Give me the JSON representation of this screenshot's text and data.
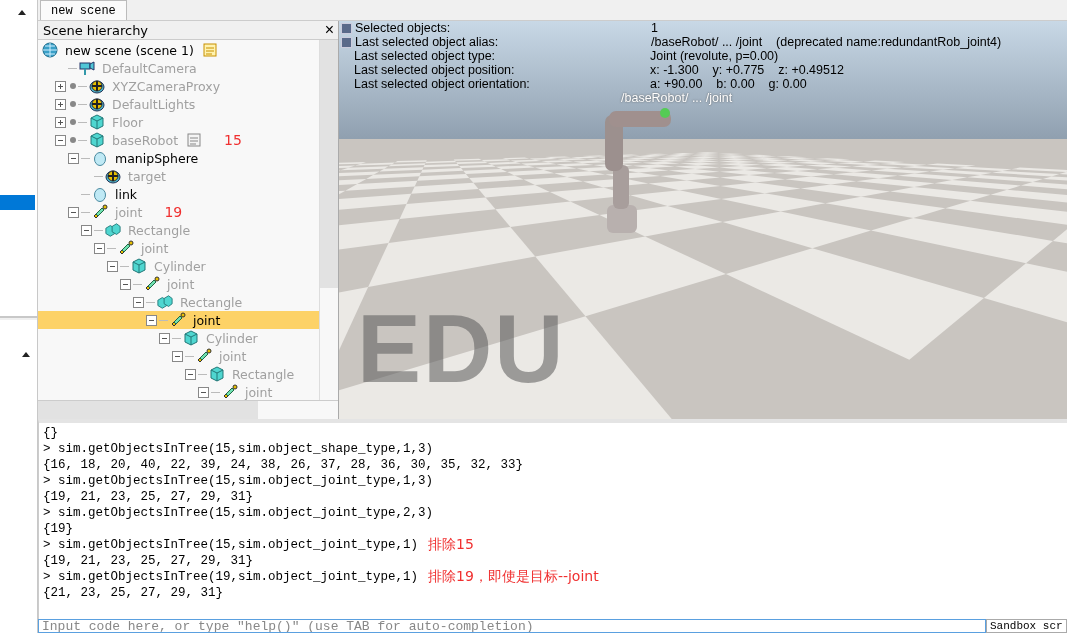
{
  "scene_tab": {
    "label": "new scene",
    "selected": true
  },
  "hierarchy": {
    "title": "Scene hierarchy",
    "close": "×",
    "items": [
      {
        "label": "new scene (scene 1)",
        "kind": "scene",
        "script": true,
        "dimmed": false,
        "selected": false,
        "children": [
          {
            "label": "DefaultCamera",
            "kind": "camera",
            "dimmed": true,
            "selected": false
          },
          {
            "label": "XYZCameraProxy",
            "kind": "dummy",
            "model": true,
            "dimmed": true,
            "selected": false,
            "expanded": false
          },
          {
            "label": "DefaultLights",
            "kind": "dummy",
            "model": true,
            "dimmed": true,
            "selected": false,
            "expanded": false
          },
          {
            "label": "Floor",
            "kind": "shape",
            "model": true,
            "dimmed": true,
            "selected": false,
            "expanded": false
          },
          {
            "label": "baseRobot",
            "kind": "shape",
            "model": true,
            "script": true,
            "note": "15",
            "dimmed": true,
            "selected": false,
            "expanded": true,
            "children": [
              {
                "label": "manipSphere",
                "kind": "sphere",
                "dimmed": false,
                "selected": false,
                "expanded": true,
                "children": [
                  {
                    "label": "target",
                    "kind": "dummy",
                    "dimmed": true,
                    "selected": false
                  }
                ]
              },
              {
                "label": "link",
                "kind": "sphere",
                "dimmed": false,
                "selected": false
              },
              {
                "label": "joint",
                "kind": "joint",
                "note": "19",
                "dimmed": true,
                "selected": false,
                "expanded": true,
                "children": [
                  {
                    "label": "Rectangle",
                    "kind": "compound",
                    "dimmed": true,
                    "selected": false,
                    "expanded": true,
                    "children": [
                      {
                        "label": "joint",
                        "kind": "joint",
                        "dimmed": true,
                        "selected": false,
                        "expanded": true,
                        "children": [
                          {
                            "label": "Cylinder",
                            "kind": "shape",
                            "dimmed": true,
                            "selected": false,
                            "expanded": true,
                            "children": [
                              {
                                "label": "joint",
                                "kind": "joint",
                                "dimmed": true,
                                "selected": false,
                                "expanded": true,
                                "children": [
                                  {
                                    "label": "Rectangle",
                                    "kind": "compound",
                                    "dimmed": true,
                                    "selected": false,
                                    "expanded": true,
                                    "children": [
                                      {
                                        "label": "joint",
                                        "kind": "joint",
                                        "dimmed": false,
                                        "selected": true,
                                        "expanded": true,
                                        "children": [
                                          {
                                            "label": "Cylinder",
                                            "kind": "shape",
                                            "dimmed": true,
                                            "selected": false,
                                            "expanded": true,
                                            "children": [
                                              {
                                                "label": "joint",
                                                "kind": "joint",
                                                "dimmed": true,
                                                "selected": false,
                                                "expanded": true,
                                                "children": [
                                                  {
                                                    "label": "Rectangle",
                                                    "kind": "shape",
                                                    "dimmed": true,
                                                    "selected": false,
                                                    "expanded": true,
                                                    "children": [
                                                      {
                                                        "label": "joint",
                                                        "kind": "joint",
                                                        "dimmed": true,
                                                        "selected": false,
                                                        "expanded": true
                                                      }
                                                    ]
                                                  }
                                                ]
                                              }
                                            ]
                                          }
                                        ]
                                      }
                                    ]
                                  }
                                ]
                              }
                            ]
                          }
                        ]
                      }
                    ]
                  }
                ]
              }
            ]
          }
        ]
      }
    ]
  },
  "info": [
    {
      "label": "Selected objects:",
      "value": "1"
    },
    {
      "label": "Last selected object alias:",
      "value": "/baseRobot/ ... /joint    (deprecated name:redundantRob_joint4)"
    },
    {
      "label": "Last selected object type:",
      "value": "Joint (revolute, p=0.00)"
    },
    {
      "label": "Last selected object position:",
      "value": "x: -1.300    y: +0.775    z: +0.49512"
    },
    {
      "label": "Last selected object orientation:",
      "value": "a: +90.00    b: 0.00    g: 0.00"
    }
  ],
  "viewport": {
    "object_label": "/baseRobot/ ... /joint",
    "edition_mark": "EDU"
  },
  "console": [
    {
      "text": "{}"
    },
    {
      "text": "> sim.getObjectsInTree(15,sim.object_shape_type,1,3)"
    },
    {
      "text": "{16, 18, 20, 40, 22, 39, 24, 38, 26, 37, 28, 36, 30, 35, 32, 33}"
    },
    {
      "text": "> sim.getObjectsInTree(15,sim.object_joint_type,1,3)"
    },
    {
      "text": "{19, 21, 23, 25, 27, 29, 31}"
    },
    {
      "text": "> sim.getObjectsInTree(15,sim.object_joint_type,2,3)"
    },
    {
      "text": "{19}"
    },
    {
      "text": "> sim.getObjectsInTree(15,sim.object_joint_type,1)",
      "note": "排除15"
    },
    {
      "text": "{19, 21, 23, 25, 27, 29, 31}"
    },
    {
      "text": "> sim.getObjectsInTree(19,sim.object_joint_type,1)",
      "note": "排除19，即使是目标--joint"
    },
    {
      "text": "{21, 23, 25, 27, 29, 31}"
    }
  ],
  "input": {
    "placeholder": "Input code here, or type \"help()\" (use TAB for auto-completion)"
  },
  "script_selector": {
    "value": "Sandbox scr"
  }
}
